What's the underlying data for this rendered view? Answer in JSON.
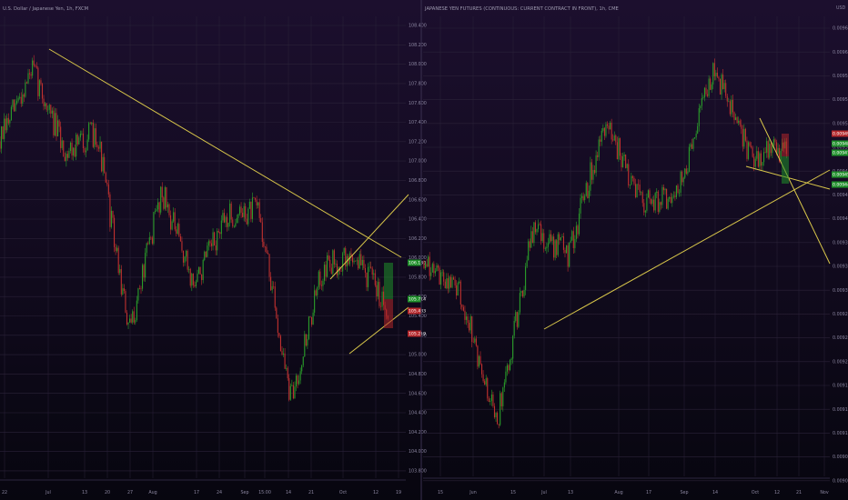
{
  "colors": {
    "up": "#2a9d2a",
    "down": "#c0312f",
    "trendline": "#d8c64a",
    "grid": "#2b2238",
    "green_tag": "#1f8f2a",
    "red_tag": "#b3262a"
  },
  "panels": [
    {
      "title": "U.S. Dollar / Japanese Yen, 1h, FXCM",
      "y_ticks": [
        "108.400",
        "108.200",
        "108.000",
        "107.800",
        "107.600",
        "107.400",
        "107.200",
        "107.000",
        "106.800",
        "106.600",
        "106.400",
        "106.200",
        "106.000",
        "105.800",
        "105.600",
        "105.400",
        "105.200",
        "105.000",
        "104.800",
        "104.600",
        "104.400",
        "104.200",
        "104.000",
        "103.800"
      ],
      "x_ticks": [
        "22",
        "Jul",
        "13",
        "20",
        "27",
        "Aug",
        "17",
        "24",
        "Sep",
        "15:00",
        "14",
        "21",
        "Oct",
        "12",
        "19"
      ],
      "price_tags": [
        {
          "label": "106.130",
          "color": "green_tag"
        },
        {
          "label": "105.714",
          "color": "green_tag"
        },
        {
          "label": "105.483",
          "color": "red_tag"
        },
        {
          "label": "105.219",
          "color": "red_tag"
        }
      ]
    },
    {
      "title": "JAPANESE YEN FUTURES (CONTINUOUS: CURRENT CONTRACT IN FRONT), 1h, CME",
      "unit": "USD",
      "y_ticks": [
        "0.0096565",
        "0.0096250",
        "0.0095940",
        "0.0095625",
        "0.0095315",
        "0.0095000",
        "0.0094690",
        "0.0094380",
        "0.0094065",
        "0.0093750",
        "0.0093440",
        "0.0093125",
        "0.0092815",
        "0.0092500",
        "0.0092190",
        "0.0091875",
        "0.0091565",
        "0.0091250",
        "0.0090940",
        "0.0090625"
      ],
      "x_ticks": [
        "15",
        "Jun",
        "15",
        "Jul",
        "13",
        "Aug",
        "17",
        "Sep",
        "14",
        "Oct",
        "12",
        "21",
        "Nov"
      ],
      "price_tags": [
        {
          "label": "0.0094918",
          "color": "red_tag"
        },
        {
          "label": "0.0094800",
          "color": "green_tag"
        },
        {
          "label": "0.0094720",
          "color": "green_tag"
        },
        {
          "label": "0.0094580",
          "color": "green_tag"
        },
        {
          "label": "0.0094480",
          "color": "green_tag"
        }
      ]
    }
  ],
  "chart_data": [
    {
      "type": "line",
      "title": "U.S. Dollar / Japanese Yen, 1h, FXCM",
      "x": [
        "22",
        "Jul",
        "13",
        "20",
        "27",
        "Aug",
        "17",
        "24",
        "Sep",
        "14",
        "21",
        "Oct",
        "12"
      ],
      "series": [
        {
          "values": [
            107.2,
            107.95,
            107.1,
            107.3,
            105.2,
            106.7,
            105.7,
            106.4,
            106.5,
            104.5,
            105.9,
            106.0,
            105.5
          ]
        }
      ],
      "ylim": [
        103.7,
        108.5
      ],
      "grid": true
    },
    {
      "type": "line",
      "title": "JAPANESE YEN FUTURES (CONTINUOUS: CURRENT CONTRACT IN FRONT), 1h, CME",
      "x": [
        "15",
        "Jun",
        "15",
        "Jul",
        "13",
        "Aug",
        "17",
        "Sep",
        "14",
        "Oct",
        "12"
      ],
      "series": [
        {
          "values": [
            0.00934,
            0.0093,
            0.00912,
            0.00938,
            0.00935,
            0.00953,
            0.00942,
            0.00943,
            0.0096,
            0.00948,
            0.00949
          ]
        }
      ],
      "ylim": [
        0.00905,
        0.00967
      ],
      "grid": true
    }
  ]
}
